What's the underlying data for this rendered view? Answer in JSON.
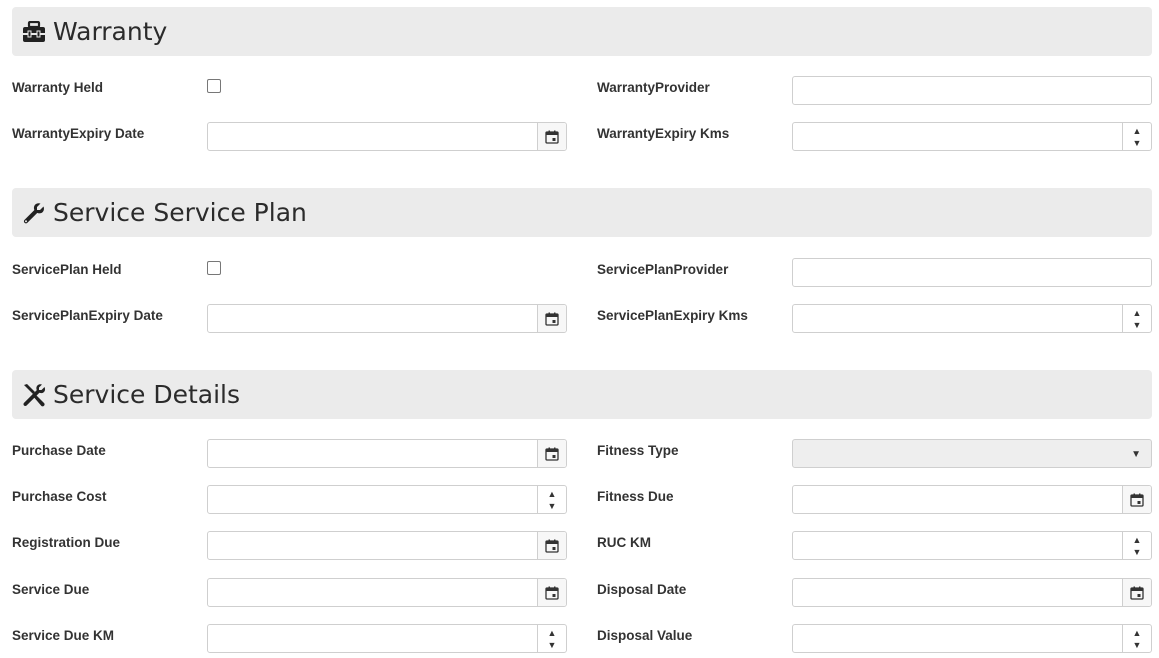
{
  "sections": {
    "warranty": {
      "title": "Warranty",
      "held_label": "Warranty Held",
      "provider_label": "WarrantyProvider",
      "expiry_date_label": "WarrantyExpiry Date",
      "expiry_kms_label": "WarrantyExpiry Kms"
    },
    "service_plan": {
      "title": "Service Service Plan",
      "held_label": "ServicePlan Held",
      "provider_label": "ServicePlanProvider",
      "expiry_date_label": "ServicePlanExpiry Date",
      "expiry_kms_label": "ServicePlanExpiry Kms"
    },
    "service_details": {
      "title": "Service Details",
      "purchase_date_label": "Purchase Date",
      "purchase_cost_label": "Purchase Cost",
      "registration_due_label": "Registration Due",
      "service_due_label": "Service Due",
      "service_due_km_label": "Service Due KM",
      "fitness_type_label": "Fitness Type",
      "fitness_due_label": "Fitness Due",
      "ruc_km_label": "RUC KM",
      "disposal_date_label": "Disposal Date",
      "disposal_value_label": "Disposal Value"
    }
  },
  "icons": {
    "warranty": "toolbox-icon",
    "service_plan": "wrench-icon",
    "service_details": "tools-icon",
    "date": "calendar-icon",
    "number": "spinner-arrows-icon",
    "select": "caret-down-icon"
  },
  "spinner": {
    "up": "▲",
    "down": "▼"
  },
  "select_caret": "▼",
  "colors": {
    "header_bg": "#ebebeb",
    "border": "#cfcfcf",
    "disabled_bg": "#eeeeee"
  }
}
